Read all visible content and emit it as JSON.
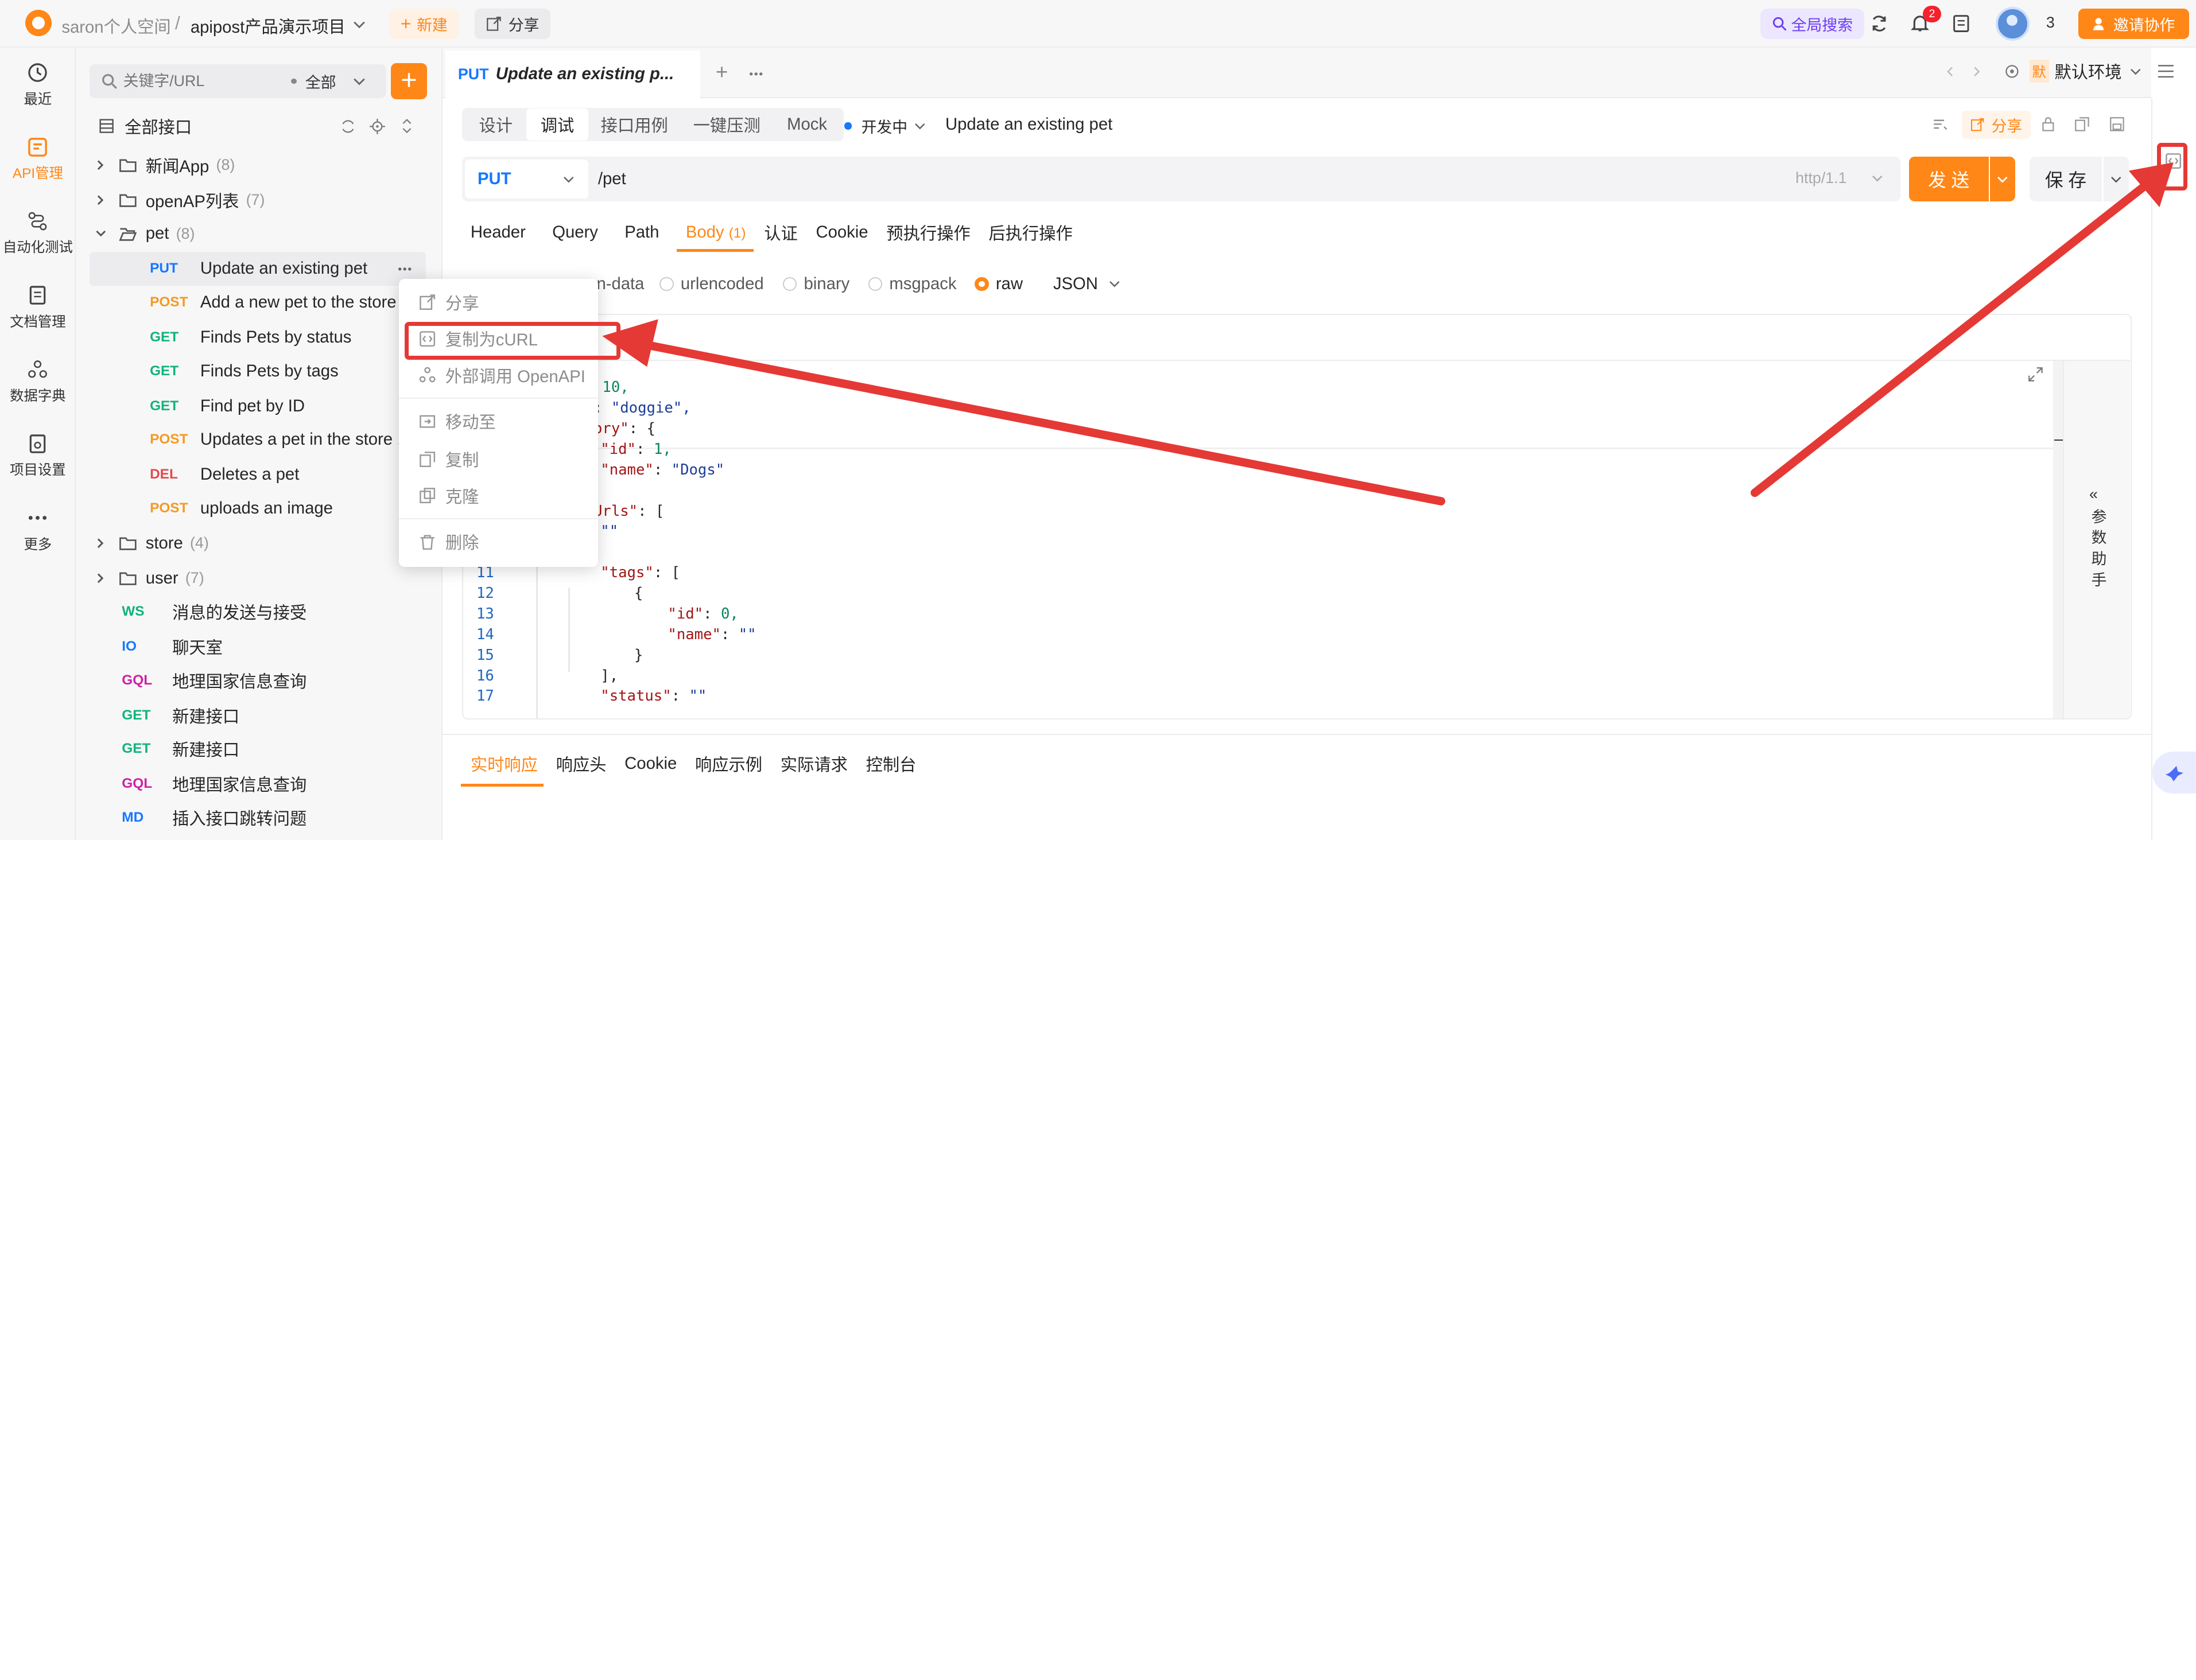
{
  "topbar": {
    "workspace": "saron个人空间",
    "separator": "/",
    "project": "apipost产品演示项目",
    "new_label": "新建",
    "share_label": "分享",
    "global_search": "全局搜索",
    "notification_badge": "2",
    "member_count": "3",
    "invite_label": "邀请协作"
  },
  "rail": {
    "items": [
      {
        "label": "最近"
      },
      {
        "label": "API管理"
      },
      {
        "label": "自动化测试"
      },
      {
        "label": "文档管理"
      },
      {
        "label": "数据字典"
      },
      {
        "label": "项目设置"
      },
      {
        "label": "更多"
      }
    ]
  },
  "sidebar": {
    "search_placeholder": "关键字/URL",
    "filter_label": "全部",
    "all_label": "全部接口",
    "folders": [
      {
        "name": "新闻App",
        "count": "(8)"
      },
      {
        "name": "openAP列表",
        "count": "(7)"
      },
      {
        "name": "pet",
        "count": "(8)"
      },
      {
        "name": "store",
        "count": "(4)"
      },
      {
        "name": "user",
        "count": "(7)"
      }
    ],
    "pet_items": [
      {
        "method": "PUT",
        "name": "Update an existing pet"
      },
      {
        "method": "POST",
        "name": "Add a new pet to the store"
      },
      {
        "method": "GET",
        "name": "Finds Pets by status"
      },
      {
        "method": "GET",
        "name": "Finds Pets by tags"
      },
      {
        "method": "GET",
        "name": "Find pet by ID"
      },
      {
        "method": "POST",
        "name": "Updates a pet in the store ..."
      },
      {
        "method": "DEL",
        "name": "Deletes a pet"
      },
      {
        "method": "POST",
        "name": "uploads an image"
      }
    ],
    "root_items": [
      {
        "method": "WS",
        "name": "消息的发送与接受"
      },
      {
        "method": "IO",
        "name": "聊天室"
      },
      {
        "method": "GQL",
        "name": "地理国家信息查询"
      },
      {
        "method": "GET",
        "name": "新建接口"
      },
      {
        "method": "GET",
        "name": "新建接口"
      },
      {
        "method": "GQL",
        "name": "地理国家信息查询"
      },
      {
        "method": "MD",
        "name": "插入接口跳转问题"
      }
    ]
  },
  "context_menu": {
    "items": [
      "分享",
      "复制为cURL",
      "外部调用 OpenAPI",
      "移动至",
      "复制",
      "克隆",
      "删除"
    ]
  },
  "editor": {
    "tab_method": "PUT",
    "tab_title": "Update an existing p...",
    "env_label": "默认环境",
    "env_badge": "默",
    "mode_tabs": [
      "设计",
      "调试",
      "接口用例",
      "一键压测",
      "Mock"
    ],
    "status": "开发中",
    "api_name": "Update an existing pet",
    "share_label": "分享",
    "method": "PUT",
    "url": "/pet",
    "protocol": "http/1.1",
    "send_label": "发 送",
    "save_label": "保 存",
    "param_tabs": [
      "Header",
      "Query",
      "Path",
      "Body",
      "认证",
      "Cookie",
      "预执行操作",
      "后执行操作"
    ],
    "body_count": "(1)",
    "body_types": [
      "form-data",
      "urlencoded",
      "binary",
      "msgpack",
      "raw"
    ],
    "body_type_prefix": "n-data",
    "raw_format": "JSON",
    "helper_label": "参数助手",
    "code_lines": [
      {
        "n": "",
        "k": ": ",
        "v": "10,",
        "cls": "num",
        "indent": 0,
        "kt": "",
        "ktail": ": "
      },
      {
        "n": "",
        "k": "me\"",
        "v": "\"doggie\",",
        "cls": "str",
        "indent": 0,
        "ktail": ": "
      },
      {
        "n": "",
        "k": "tegory\"",
        "v": "{",
        "cls": "",
        "indent": 0,
        "ktail": ": "
      },
      {
        "n": "",
        "k": "\"id\"",
        "v": "1,",
        "cls": "num",
        "indent": 1,
        "ktail": ": "
      },
      {
        "n": "",
        "k": "\"name\"",
        "v": "\"Dogs\"",
        "cls": "str",
        "indent": 1,
        "ktail": ": "
      },
      {
        "n": "",
        "k": "",
        "v": "",
        "cls": "",
        "indent": 0,
        "ktail": ""
      },
      {
        "n": "",
        "k": "otoUrls\"",
        "v": "[",
        "cls": "",
        "indent": 0,
        "ktail": ": "
      },
      {
        "n": "",
        "k": "",
        "v": "\"\"",
        "cls": "str",
        "indent": 1,
        "ktail": ""
      },
      {
        "n": "",
        "k": "",
        "v": "",
        "cls": "",
        "indent": 0,
        "ktail": ""
      },
      {
        "n": "11",
        "k": "\"tags\"",
        "v": "[",
        "cls": "",
        "indent": 1,
        "ktail": ": "
      },
      {
        "n": "12",
        "k": "",
        "v": "{",
        "cls": "",
        "indent": 2,
        "ktail": ""
      },
      {
        "n": "13",
        "k": "\"id\"",
        "v": "0,",
        "cls": "num",
        "indent": 3,
        "ktail": ": "
      },
      {
        "n": "14",
        "k": "\"name\"",
        "v": "\"\"",
        "cls": "str",
        "indent": 3,
        "ktail": ": "
      },
      {
        "n": "15",
        "k": "",
        "v": "}",
        "cls": "",
        "indent": 2,
        "ktail": ""
      },
      {
        "n": "16",
        "k": "",
        "v": "],",
        "cls": "",
        "indent": 1,
        "ktail": ""
      },
      {
        "n": "17",
        "k": "\"status\"",
        "v": "\"\"",
        "cls": "str",
        "indent": 1,
        "ktail": ": "
      }
    ],
    "response_tabs": [
      "实时响应",
      "响应头",
      "Cookie",
      "响应示例",
      "实际请求",
      "控制台"
    ]
  },
  "colors": {
    "accent": "#ff8717",
    "annotation_red": "#e53935",
    "purple": "#6c3df0"
  }
}
